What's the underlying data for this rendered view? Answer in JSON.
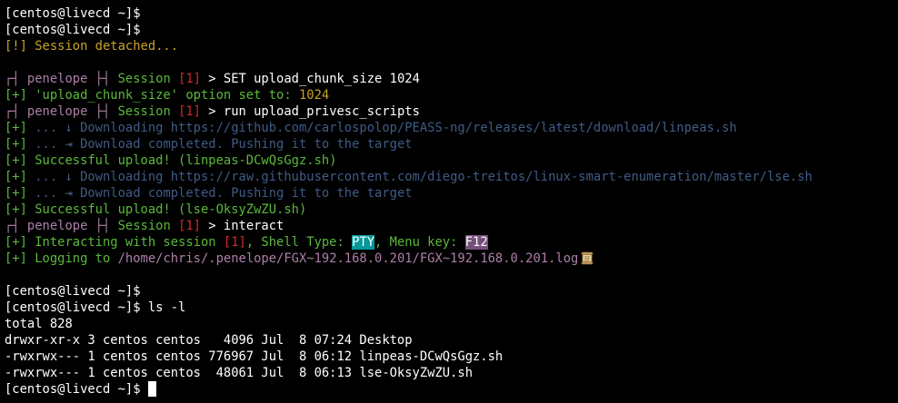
{
  "terminal": {
    "lines": [
      {
        "segments": [
          {
            "text": "[centos@livecd ~]$",
            "color": "white"
          }
        ]
      },
      {
        "segments": [
          {
            "text": "[centos@livecd ~]$",
            "color": "white"
          }
        ]
      },
      {
        "segments": [
          {
            "text": "[!] Session detached...",
            "color": "yellow"
          }
        ]
      },
      {
        "segments": []
      },
      {
        "segments": [
          {
            "text": "┌┤ penelope ├┤ ",
            "color": "purple"
          },
          {
            "text": "Session ",
            "color": "green"
          },
          {
            "text": "[1]",
            "color": "red"
          },
          {
            "text": " > SET upload_chunk_size 1024",
            "color": "white"
          }
        ]
      },
      {
        "segments": [
          {
            "text": "[+] 'upload_chunk_size' option set to: ",
            "color": "green"
          },
          {
            "text": "1024",
            "color": "yellow"
          }
        ]
      },
      {
        "segments": [
          {
            "text": "┌┤ penelope ├┤ ",
            "color": "purple"
          },
          {
            "text": "Session ",
            "color": "green"
          },
          {
            "text": "[1]",
            "color": "red"
          },
          {
            "text": " > run upload_privesc_scripts",
            "color": "white"
          }
        ]
      },
      {
        "segments": [
          {
            "text": "[+] ",
            "color": "green"
          },
          {
            "text": "... ↓ Downloading https://github.com/carlospolop/PEASS-ng/releases/latest/download/linpeas.sh",
            "color": "blue"
          }
        ]
      },
      {
        "segments": [
          {
            "text": "[+] ",
            "color": "green"
          },
          {
            "text": "... ⇥ Download completed. Pushing it to the target",
            "color": "blue"
          }
        ]
      },
      {
        "segments": [
          {
            "text": "[+] Successful upload! (linpeas-DCwQsGgz.sh)",
            "color": "green"
          }
        ]
      },
      {
        "segments": [
          {
            "text": "[+] ",
            "color": "green"
          },
          {
            "text": "... ↓ Downloading https://raw.githubusercontent.com/diego-treitos/linux-smart-enumeration/master/lse.sh",
            "color": "blue"
          }
        ]
      },
      {
        "segments": [
          {
            "text": "[+] ",
            "color": "green"
          },
          {
            "text": "... ⇥ Download completed. Pushing it to the target",
            "color": "blue"
          }
        ]
      },
      {
        "segments": [
          {
            "text": "[+] Successful upload! (lse-OksyZwZU.sh)",
            "color": "green"
          }
        ]
      },
      {
        "segments": [
          {
            "text": "┌┤ penelope ├┤ ",
            "color": "purple"
          },
          {
            "text": "Session ",
            "color": "green"
          },
          {
            "text": "[1]",
            "color": "red"
          },
          {
            "text": " > interact",
            "color": "white"
          }
        ]
      },
      {
        "segments": [
          {
            "text": "[+] Interacting with session ",
            "color": "green"
          },
          {
            "text": "[1]",
            "color": "red"
          },
          {
            "text": ", Shell Type: ",
            "color": "green"
          },
          {
            "text": "PTY",
            "color": "hl-cyan"
          },
          {
            "text": ", Menu key: ",
            "color": "green"
          },
          {
            "text": "F12",
            "color": "hl-purple"
          }
        ]
      },
      {
        "segments": [
          {
            "text": "[+] Logging to ",
            "color": "green"
          },
          {
            "text": "/home/chris/.penelope/FGX~192.168.0.201/FGX~192.168.0.201.log",
            "color": "purple"
          }
        ],
        "icon": "scroll-icon"
      },
      {
        "segments": []
      },
      {
        "segments": [
          {
            "text": "[centos@livecd ~]$",
            "color": "white"
          }
        ]
      },
      {
        "segments": [
          {
            "text": "[centos@livecd ~]$ ls -l",
            "color": "white"
          }
        ]
      },
      {
        "segments": [
          {
            "text": "total 828",
            "color": "white"
          }
        ]
      },
      {
        "segments": [
          {
            "text": "drwxr-xr-x 3 centos centos   4096 Jul  8 07:24 Desktop",
            "color": "white"
          }
        ]
      },
      {
        "segments": [
          {
            "text": "-rwxrwx--- 1 centos centos 776967 Jul  8 06:12 linpeas-DCwQsGgz.sh",
            "color": "white"
          }
        ]
      },
      {
        "segments": [
          {
            "text": "-rwxrwx--- 1 centos centos  48061 Jul  8 06:13 lse-OksyZwZU.sh",
            "color": "white"
          }
        ]
      },
      {
        "segments": [
          {
            "text": "[centos@livecd ~]$ ",
            "color": "white"
          }
        ],
        "cursor": true
      }
    ]
  },
  "colors": {
    "background": "#000000",
    "white": "#ffffff",
    "green": "#5ab93b",
    "yellow": "#c9a227",
    "purple": "#ad7fa8",
    "red": "#d22b2b",
    "blue": "#3f5b86",
    "hl-cyan": "#06989a",
    "hl-purple": "#75507b"
  }
}
